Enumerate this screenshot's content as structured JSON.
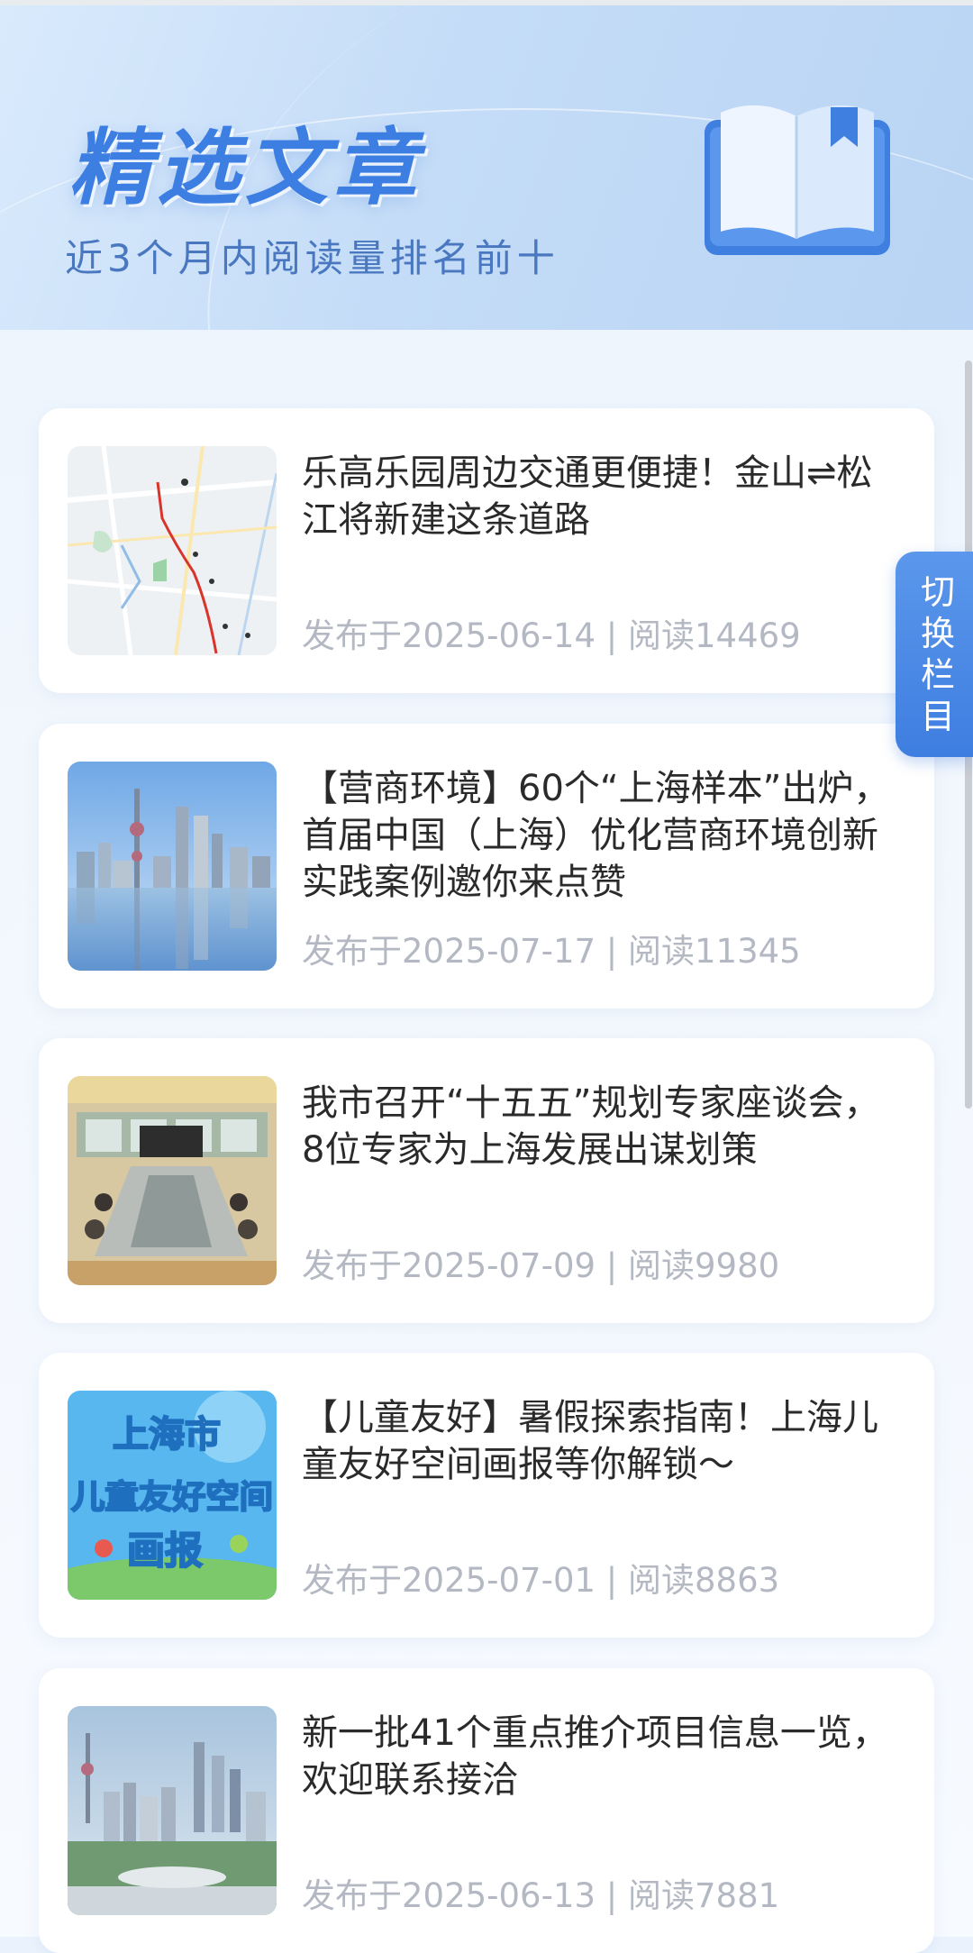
{
  "header": {
    "title": "精选文章",
    "subtitle": "近3个月内阅读量排名前十"
  },
  "side_tab": {
    "label": "切换栏目"
  },
  "articles": [
    {
      "title": "乐高乐园周边交通更便捷！金山⇌松江将新建这条道路",
      "meta": "发布于2025-06-14 | 阅读14469",
      "thumb": "map-image"
    },
    {
      "title": "【营商环境】60个“上海样本”出炉，首届中国（上海）优化营商环境创新实践案例邀你来点赞",
      "meta": "发布于2025-07-17 | 阅读11345",
      "thumb": "skyline-image"
    },
    {
      "title": "我市召开“十五五”规划专家座谈会，8位专家为上海发展出谋划策",
      "meta": "发布于2025-07-09 | 阅读9980",
      "thumb": "meeting-image"
    },
    {
      "title": "【儿童友好】暑假探索指南！上海儿童友好空间画报等你解锁～",
      "meta": "发布于2025-07-01 | 阅读8863",
      "thumb": "poster-image"
    },
    {
      "title": "新一批41个重点推介项目信息一览，欢迎联系接洽",
      "meta": "发布于2025-06-13 | 阅读7881",
      "thumb": "city-image"
    }
  ],
  "poster_text": {
    "line1": "上海市",
    "line2": "儿童友好空间",
    "line3": "画报"
  },
  "colors": {
    "accent": "#3e7ee0",
    "title_text": "#2a2a2a",
    "meta_text": "#b3b8c2"
  }
}
